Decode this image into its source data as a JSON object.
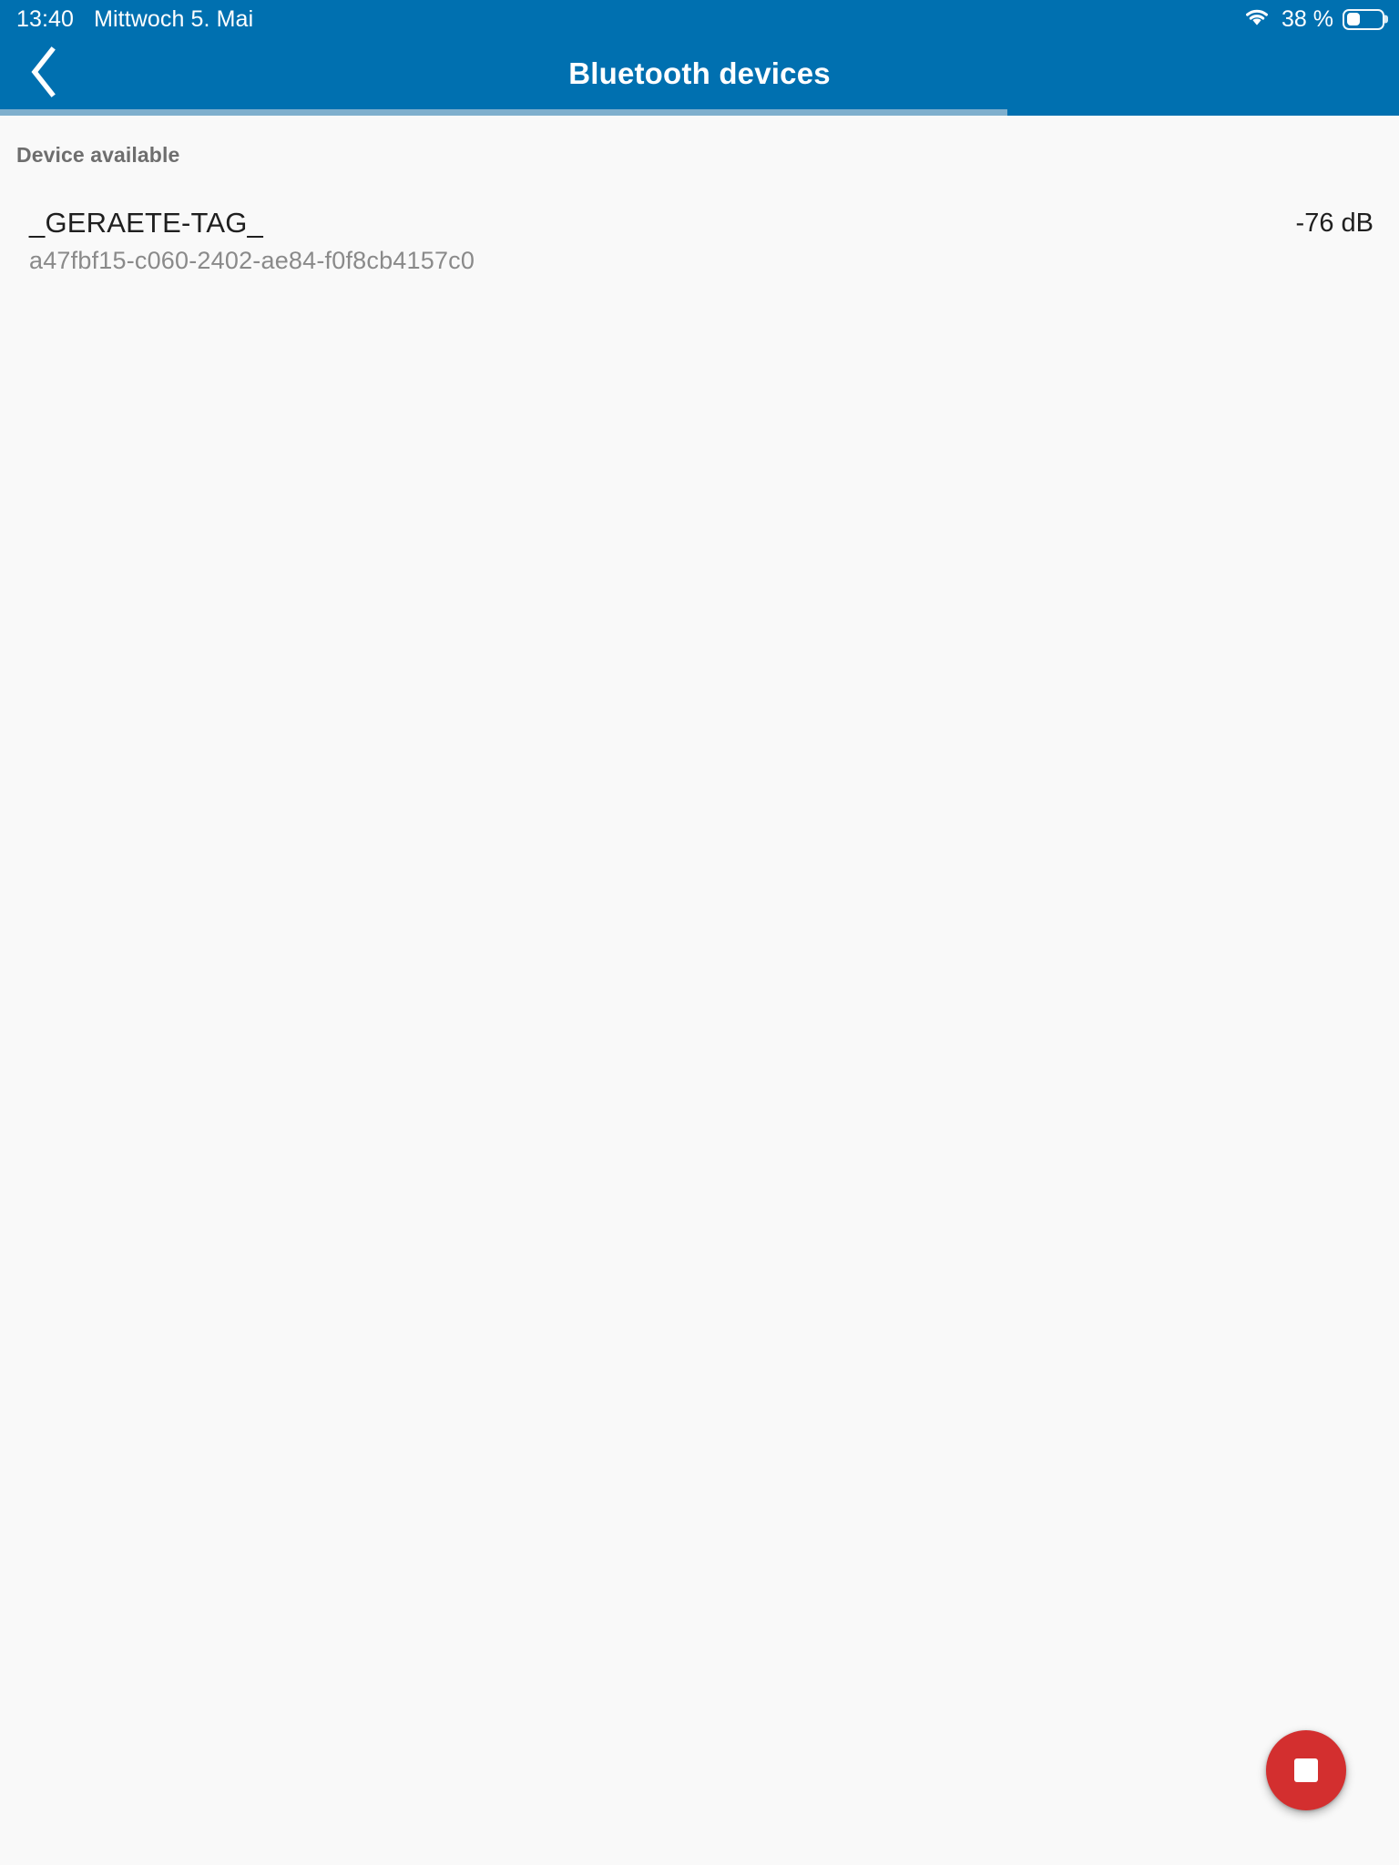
{
  "status_bar": {
    "time": "13:40",
    "date": "Mittwoch 5. Mai",
    "wifi_icon": "wifi-icon",
    "battery_percent_label": "38 %",
    "battery_level": 38,
    "battery_icon": "battery-icon"
  },
  "app_bar": {
    "back_icon": "chevron-left-icon",
    "title": "Bluetooth devices",
    "background_color": "#0070b0",
    "text_color": "#ffffff"
  },
  "progress": {
    "indicator_percent": 72,
    "track_color": "#0070b0",
    "indicator_color": "#7fafcd"
  },
  "content": {
    "section_header": "Device available",
    "devices": [
      {
        "name": "_GERAETE-TAG_",
        "uuid": "a47fbf15-c060-2402-ae84-f0f8cb4157c0",
        "signal": "-76 dB"
      }
    ]
  },
  "fab": {
    "icon": "stop-square-icon",
    "color": "#d32f2f",
    "icon_color": "#ffffff"
  }
}
